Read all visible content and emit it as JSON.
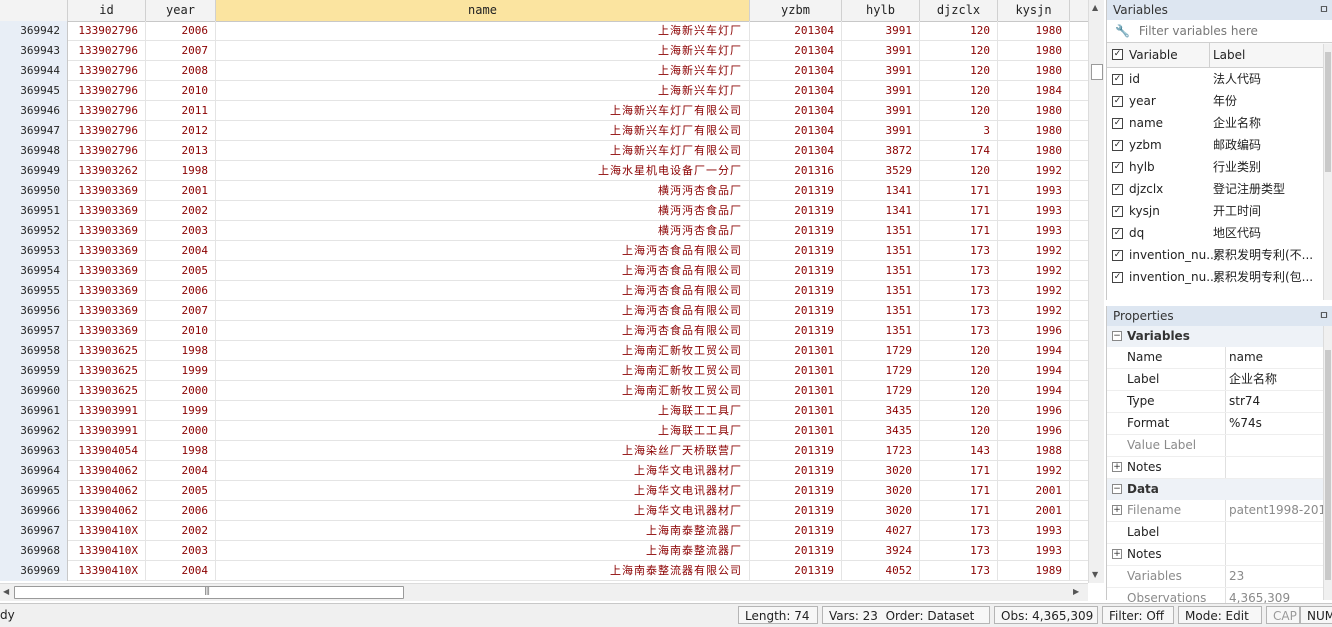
{
  "grid": {
    "columns": [
      {
        "key": "obs",
        "label": ""
      },
      {
        "key": "id",
        "label": "id"
      },
      {
        "key": "year",
        "label": "year"
      },
      {
        "key": "name",
        "label": "name"
      },
      {
        "key": "yzbm",
        "label": "yzbm"
      },
      {
        "key": "hylb",
        "label": "hylb"
      },
      {
        "key": "djzclx",
        "label": "djzclx"
      },
      {
        "key": "kysjn",
        "label": "kysjn"
      }
    ],
    "rows": [
      [
        "369942",
        "133902796",
        "2006",
        "上海新兴车灯厂",
        "201304",
        "3991",
        "120",
        "1980"
      ],
      [
        "369943",
        "133902796",
        "2007",
        "上海新兴车灯厂",
        "201304",
        "3991",
        "120",
        "1980"
      ],
      [
        "369944",
        "133902796",
        "2008",
        "上海新兴车灯厂",
        "201304",
        "3991",
        "120",
        "1980"
      ],
      [
        "369945",
        "133902796",
        "2010",
        "上海新兴车灯厂",
        "201304",
        "3991",
        "120",
        "1984"
      ],
      [
        "369946",
        "133902796",
        "2011",
        "上海新兴车灯厂有限公司",
        "201304",
        "3991",
        "120",
        "1980"
      ],
      [
        "369947",
        "133902796",
        "2012",
        "上海新兴车灯厂有限公司",
        "201304",
        "3991",
        "3",
        "1980"
      ],
      [
        "369948",
        "133902796",
        "2013",
        "上海新兴车灯厂有限公司",
        "201304",
        "3872",
        "174",
        "1980"
      ],
      [
        "369949",
        "133903262",
        "1998",
        "上海水星机电设备厂一分厂",
        "201316",
        "3529",
        "120",
        "1992"
      ],
      [
        "369950",
        "133903369",
        "2001",
        "横沔沔杏食品厂",
        "201319",
        "1341",
        "171",
        "1993"
      ],
      [
        "369951",
        "133903369",
        "2002",
        "横沔沔杏食品厂",
        "201319",
        "1341",
        "171",
        "1993"
      ],
      [
        "369952",
        "133903369",
        "2003",
        "横沔沔杏食品厂",
        "201319",
        "1351",
        "171",
        "1993"
      ],
      [
        "369953",
        "133903369",
        "2004",
        "上海沔杏食品有限公司",
        "201319",
        "1351",
        "173",
        "1992"
      ],
      [
        "369954",
        "133903369",
        "2005",
        "上海沔杏食品有限公司",
        "201319",
        "1351",
        "173",
        "1992"
      ],
      [
        "369955",
        "133903369",
        "2006",
        "上海沔杏食品有限公司",
        "201319",
        "1351",
        "173",
        "1992"
      ],
      [
        "369956",
        "133903369",
        "2007",
        "上海沔杏食品有限公司",
        "201319",
        "1351",
        "173",
        "1992"
      ],
      [
        "369957",
        "133903369",
        "2010",
        "上海沔杏食品有限公司",
        "201319",
        "1351",
        "173",
        "1996"
      ],
      [
        "369958",
        "133903625",
        "1998",
        "上海南汇新牧工贸公司",
        "201301",
        "1729",
        "120",
        "1994"
      ],
      [
        "369959",
        "133903625",
        "1999",
        "上海南汇新牧工贸公司",
        "201301",
        "1729",
        "120",
        "1994"
      ],
      [
        "369960",
        "133903625",
        "2000",
        "上海南汇新牧工贸公司",
        "201301",
        "1729",
        "120",
        "1994"
      ],
      [
        "369961",
        "133903991",
        "1999",
        "上海联工工具厂",
        "201301",
        "3435",
        "120",
        "1996"
      ],
      [
        "369962",
        "133903991",
        "2000",
        "上海联工工具厂",
        "201301",
        "3435",
        "120",
        "1996"
      ],
      [
        "369963",
        "133904054",
        "1998",
        "上海染丝厂天桥联营厂",
        "201319",
        "1723",
        "143",
        "1988"
      ],
      [
        "369964",
        "133904062",
        "2004",
        "上海华文电讯器材厂",
        "201319",
        "3020",
        "171",
        "1992"
      ],
      [
        "369965",
        "133904062",
        "2005",
        "上海华文电讯器材厂",
        "201319",
        "3020",
        "171",
        "2001"
      ],
      [
        "369966",
        "133904062",
        "2006",
        "上海华文电讯器材厂",
        "201319",
        "3020",
        "171",
        "2001"
      ],
      [
        "369967",
        "13390410X",
        "2002",
        "上海南泰整流器厂",
        "201319",
        "4027",
        "173",
        "1993"
      ],
      [
        "369968",
        "13390410X",
        "2003",
        "上海南泰整流器厂",
        "201319",
        "3924",
        "173",
        "1993"
      ],
      [
        "369969",
        "13390410X",
        "2004",
        "上海南泰整流器有限公司",
        "201319",
        "4052",
        "173",
        "1989"
      ]
    ]
  },
  "variables_panel": {
    "title": "Variables",
    "pin": "ㅁ",
    "filter_placeholder": "Filter variables here",
    "col_variable": "Variable",
    "col_label": "Label",
    "items": [
      {
        "name": "id",
        "label": "法人代码"
      },
      {
        "name": "year",
        "label": "年份"
      },
      {
        "name": "name",
        "label": "企业名称"
      },
      {
        "name": "yzbm",
        "label": "邮政编码"
      },
      {
        "name": "hylb",
        "label": "行业类别"
      },
      {
        "name": "djzclx",
        "label": "登记注册类型"
      },
      {
        "name": "kysjn",
        "label": "开工时间"
      },
      {
        "name": "dq",
        "label": "地区代码"
      },
      {
        "name": "invention_nu...",
        "label": "累积发明专利(不..."
      },
      {
        "name": "invention_nu...",
        "label": "累积发明专利(包..."
      }
    ]
  },
  "properties_panel": {
    "title": "Properties",
    "pin": "ㅁ",
    "variables_group": "Variables",
    "var_props": [
      {
        "key": "Name",
        "value": "name",
        "dim": false,
        "expand": false
      },
      {
        "key": "Label",
        "value": "企业名称",
        "dim": false,
        "expand": false
      },
      {
        "key": "Type",
        "value": "str74",
        "dim": false,
        "expand": false
      },
      {
        "key": "Format",
        "value": "%74s",
        "dim": false,
        "expand": false
      },
      {
        "key": "Value Label",
        "value": "",
        "dim": true,
        "expand": false
      },
      {
        "key": "Notes",
        "value": "",
        "dim": false,
        "expand": true
      }
    ],
    "data_group": "Data",
    "data_props": [
      {
        "key": "Filename",
        "value": "patent1998-201",
        "dim": true,
        "expand": true
      },
      {
        "key": "Label",
        "value": "",
        "dim": false,
        "expand": false
      },
      {
        "key": "Notes",
        "value": "",
        "dim": false,
        "expand": true
      },
      {
        "key": "Variables",
        "value": "23",
        "dim": true,
        "expand": false
      },
      {
        "key": "Observations",
        "value": "4,365,309",
        "dim": true,
        "expand": false
      }
    ]
  },
  "status": {
    "ready": "dy",
    "length": "Length: 74",
    "vars": "Vars: 23",
    "order": "Order: Dataset",
    "obs": "Obs: 4,365,309",
    "filter": "Filter: Off",
    "mode": "Mode: Edit",
    "cap": "CAP",
    "num": "NUM"
  },
  "colors": {
    "data_text": "#8b0000",
    "selected_header": "#fbe4a0",
    "panel_title_bg": "#dde6f1"
  }
}
